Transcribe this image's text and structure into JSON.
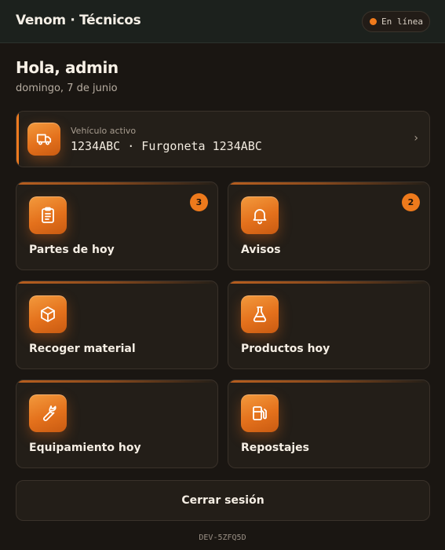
{
  "header": {
    "app_title": "Venom · Técnicos",
    "status_label": "En línea",
    "status_color": "#f07a1c"
  },
  "greeting": {
    "title": "Hola, admin",
    "date": "domingo, 7 de junio"
  },
  "vehicle": {
    "label": "Vehículo activo",
    "value": "1234ABC · Furgoneta 1234ABC",
    "chevron": "›",
    "icon": "truck-icon"
  },
  "tiles": [
    {
      "label": "Partes de hoy",
      "icon": "clipboard-icon",
      "badge": "3"
    },
    {
      "label": "Avisos",
      "icon": "bell-icon",
      "badge": "2"
    },
    {
      "label": "Recoger material",
      "icon": "box-icon"
    },
    {
      "label": "Productos hoy",
      "icon": "flask-icon"
    },
    {
      "label": "Equipamiento hoy",
      "icon": "wrench-icon"
    },
    {
      "label": "Repostajes",
      "icon": "fuel-pump-icon"
    }
  ],
  "logout_label": "Cerrar sesión",
  "device_id": "DEV-5ZFQ5D",
  "colors": {
    "accent": "#ee7a1c",
    "background": "#1a1612",
    "card": "#231e18"
  }
}
